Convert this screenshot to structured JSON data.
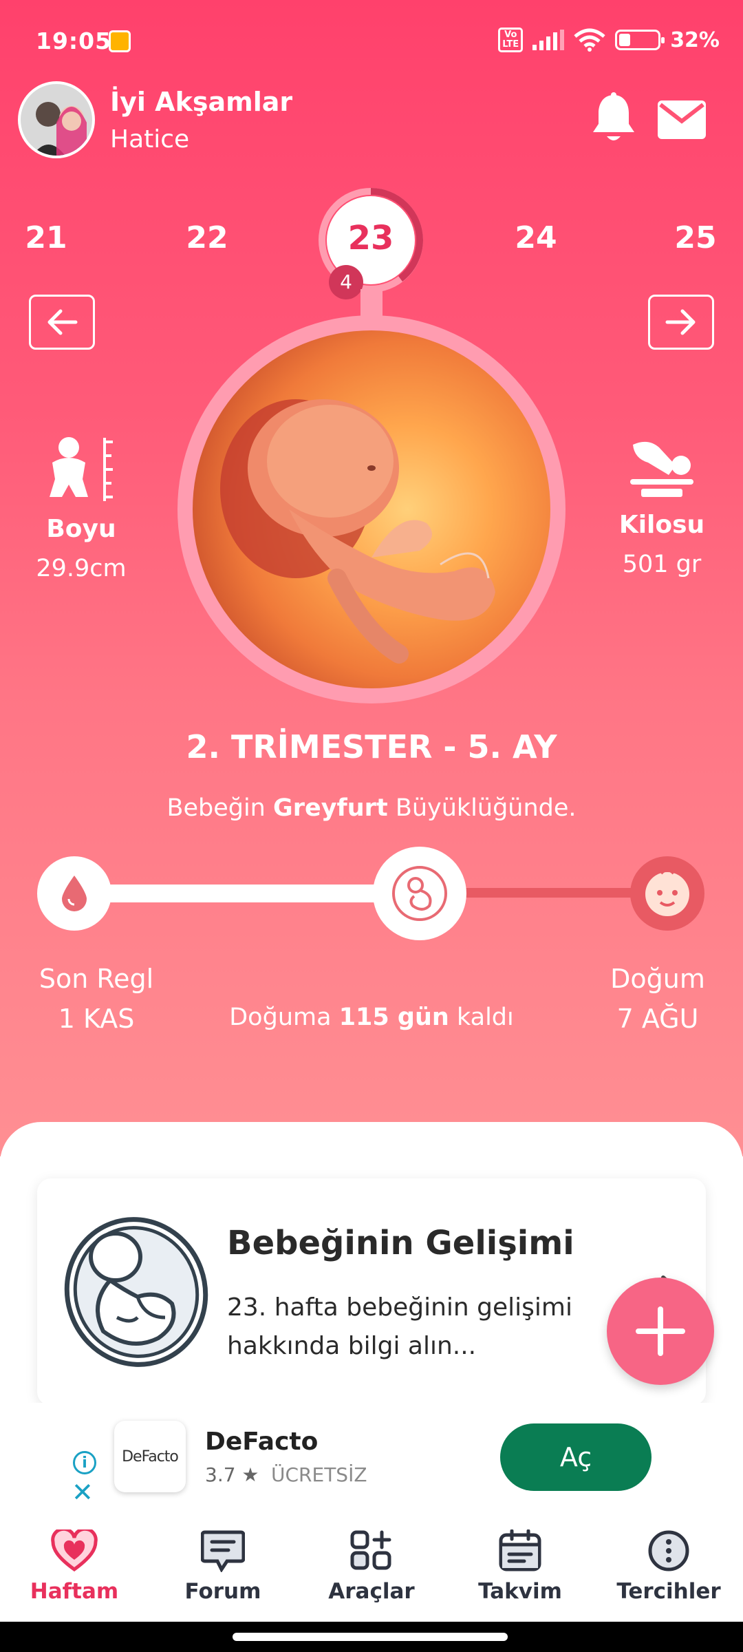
{
  "status_bar": {
    "time": "19:05",
    "network": "VoLTE",
    "battery": "32%"
  },
  "header": {
    "greeting": "İyi Akşamlar",
    "name": "Hatice"
  },
  "weeks": {
    "items": [
      "21",
      "22",
      "23",
      "24",
      "25"
    ],
    "current": "23",
    "badge": "4"
  },
  "stats": {
    "height_label": "Boyu",
    "height_value": "29.9cm",
    "weight_label": "Kilosu",
    "weight_value": "501 gr"
  },
  "trimester": "2. TRİMESTER - 5. AY",
  "size": {
    "prefix": "Bebeğin",
    "fruit": "Greyfurt",
    "suffix": "Büyüklüğünde."
  },
  "timeline": {
    "start_label": "Son Regl",
    "start_date": "1 KAS",
    "end_label": "Doğum",
    "end_date": "7 AĞU",
    "countdown_prefix": "Doğuma",
    "countdown_value": "115 gün",
    "countdown_suffix": "kaldı"
  },
  "card": {
    "title": "Bebeğinin Gelişimi",
    "description": "23. hafta bebeğinin gelişimi hakkında bilgi alın..."
  },
  "ad": {
    "logo_text": "DeFacto",
    "name": "DeFacto",
    "rating": "3.7 ★",
    "price": "ÜCRETSİZ",
    "button": "Aç"
  },
  "bottom_nav": [
    {
      "label": "Haftam",
      "icon": "heart-icon"
    },
    {
      "label": "Forum",
      "icon": "chat-icon"
    },
    {
      "label": "Araçlar",
      "icon": "tools-icon"
    },
    {
      "label": "Takvim",
      "icon": "calendar-icon"
    },
    {
      "label": "Tercihler",
      "icon": "more-icon"
    }
  ],
  "colors": {
    "accent": "#e8305c",
    "hero_top": "#ff416c",
    "hero_bottom": "#ff8f93",
    "ad_button": "#0a7d53",
    "fab": "#f76585"
  }
}
